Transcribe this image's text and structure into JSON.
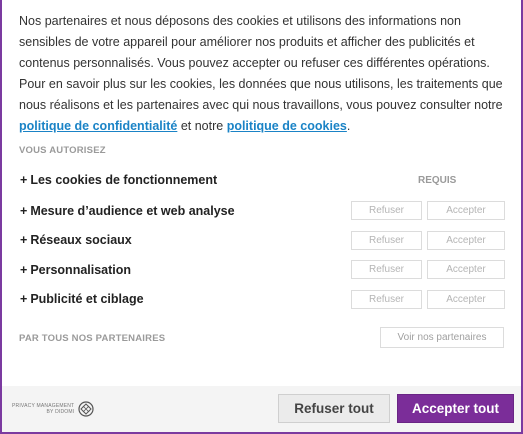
{
  "intro": {
    "text_main": "Nos partenaires et nous déposons des cookies et utilisons des informations non sensibles de votre appareil pour améliorer nos produits et afficher des publicités et contenus personnalisés. Vous pouvez accepter ou refuser ces différentes opérations. Pour en savoir plus sur les cookies, les données que nous utilisons, les traitements que nous réalisons et les partenaires avec qui nous travaillons, vous pouvez consulter notre ",
    "privacy_link": "politique de confidentialité",
    "connector": " et notre ",
    "cookie_link": "politique de cookies",
    "end": "."
  },
  "authorize_label": "VOUS AUTORISEZ",
  "required_label": "REQUIS",
  "purposes": [
    {
      "plus": "+",
      "label": "Les cookies de fonctionnement"
    },
    {
      "plus": "+",
      "label": "Mesure d’audience et web analyse"
    },
    {
      "plus": "+",
      "label": "Réseaux sociaux"
    },
    {
      "plus": "+",
      "label": "Personnalisation"
    },
    {
      "plus": "+",
      "label": "Publicité et ciblage"
    }
  ],
  "buttons": {
    "refuse_small": "Refuser",
    "accept_small": "Accepter",
    "see_partners": "Voir nos partenaires",
    "refuse_all": "Refuser tout",
    "accept_all": "Accepter tout"
  },
  "partners_label": "PAR TOUS NOS PARTENAIRES",
  "brand": {
    "line1": "PRIVACY MANAGEMENT",
    "line2": "BY DIDOMI",
    "icon": "didomi-logo-icon"
  },
  "colors": {
    "accent": "#7b2d99",
    "link": "#1a83c6"
  }
}
